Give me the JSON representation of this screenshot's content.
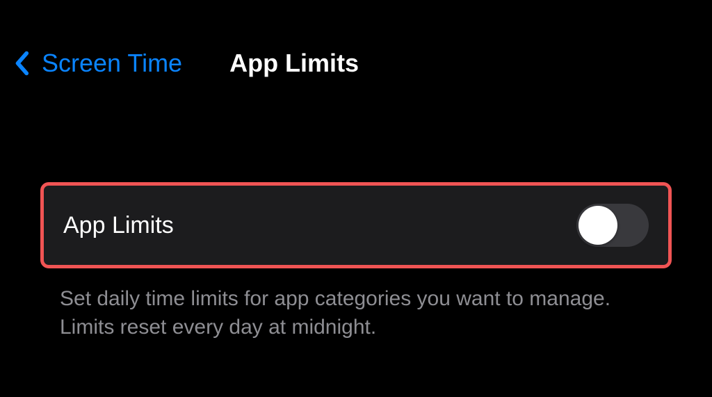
{
  "header": {
    "back_label": "Screen Time",
    "title": "App Limits"
  },
  "main": {
    "toggle_label": "App Limits",
    "toggle_state": "off",
    "description": "Set daily time limits for app categories you want to manage. Limits reset every day at midnight."
  },
  "colors": {
    "accent": "#0a84ff",
    "highlight_border": "#f05454",
    "row_bg": "#1c1c1e",
    "toggle_off_bg": "#39393d"
  }
}
